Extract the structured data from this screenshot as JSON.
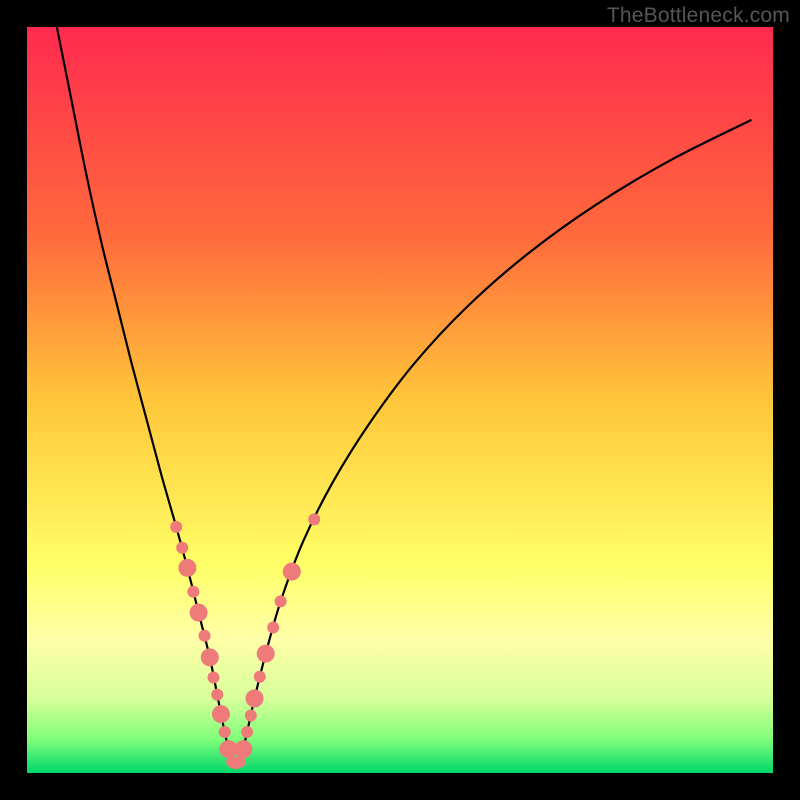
{
  "watermark": "TheBottleneck.com",
  "chart_data": {
    "type": "line",
    "title": "",
    "xlabel": "",
    "ylabel": "",
    "xlim": [
      0,
      100
    ],
    "ylim": [
      0,
      100
    ],
    "gradient_stops": [
      {
        "offset": 0.0,
        "color": "#ff2a4f"
      },
      {
        "offset": 0.28,
        "color": "#ff6a3c"
      },
      {
        "offset": 0.5,
        "color": "#ffc63a"
      },
      {
        "offset": 0.72,
        "color": "#ffff66"
      },
      {
        "offset": 0.82,
        "color": "#ffffa8"
      },
      {
        "offset": 0.9,
        "color": "#d8ff9a"
      },
      {
        "offset": 0.955,
        "color": "#7fff7a"
      },
      {
        "offset": 1.0,
        "color": "#00d66b"
      }
    ],
    "series": [
      {
        "name": "bottleneck-curve",
        "color": "#000000",
        "stroke_width": 2.2,
        "x": [
          4.0,
          6.0,
          8.0,
          10.0,
          12.0,
          14.0,
          16.0,
          18.0,
          20.0,
          21.5,
          23.0,
          24.5,
          25.5,
          26.5,
          27.5,
          28.5,
          29.5,
          30.5,
          32.0,
          34.0,
          37.0,
          41.0,
          46.0,
          52.0,
          59.0,
          67.0,
          76.0,
          86.0,
          97.0
        ],
        "y": [
          100.0,
          90.0,
          80.0,
          71.0,
          63.0,
          55.0,
          47.5,
          40.0,
          33.0,
          27.5,
          21.5,
          15.5,
          10.5,
          5.5,
          1.5,
          1.5,
          5.5,
          10.0,
          16.0,
          23.0,
          31.0,
          39.0,
          47.0,
          55.0,
          62.5,
          69.5,
          76.0,
          82.0,
          87.5
        ]
      }
    ],
    "markers": {
      "name": "data-points",
      "color": "#ef7a7a",
      "radius_small": 6,
      "radius_large": 9,
      "points": [
        {
          "x": 20.0,
          "y": 33.0,
          "r": "small"
        },
        {
          "x": 20.8,
          "y": 30.2,
          "r": "small"
        },
        {
          "x": 21.5,
          "y": 27.5,
          "r": "large"
        },
        {
          "x": 22.3,
          "y": 24.3,
          "r": "small"
        },
        {
          "x": 23.0,
          "y": 21.5,
          "r": "large"
        },
        {
          "x": 23.8,
          "y": 18.4,
          "r": "small"
        },
        {
          "x": 24.5,
          "y": 15.5,
          "r": "large"
        },
        {
          "x": 25.0,
          "y": 12.8,
          "r": "small"
        },
        {
          "x": 25.5,
          "y": 10.5,
          "r": "small"
        },
        {
          "x": 26.0,
          "y": 7.9,
          "r": "large"
        },
        {
          "x": 26.5,
          "y": 5.5,
          "r": "small"
        },
        {
          "x": 27.0,
          "y": 3.2,
          "r": "large"
        },
        {
          "x": 27.5,
          "y": 1.5,
          "r": "small"
        },
        {
          "x": 28.0,
          "y": 1.3,
          "r": "small"
        },
        {
          "x": 28.5,
          "y": 1.5,
          "r": "small"
        },
        {
          "x": 29.0,
          "y": 3.2,
          "r": "large"
        },
        {
          "x": 29.5,
          "y": 5.5,
          "r": "small"
        },
        {
          "x": 30.0,
          "y": 7.7,
          "r": "small"
        },
        {
          "x": 30.5,
          "y": 10.0,
          "r": "large"
        },
        {
          "x": 31.2,
          "y": 12.9,
          "r": "small"
        },
        {
          "x": 32.0,
          "y": 16.0,
          "r": "large"
        },
        {
          "x": 33.0,
          "y": 19.5,
          "r": "small"
        },
        {
          "x": 34.0,
          "y": 23.0,
          "r": "small"
        },
        {
          "x": 35.5,
          "y": 27.0,
          "r": "large"
        },
        {
          "x": 38.5,
          "y": 34.0,
          "r": "small"
        }
      ]
    }
  }
}
